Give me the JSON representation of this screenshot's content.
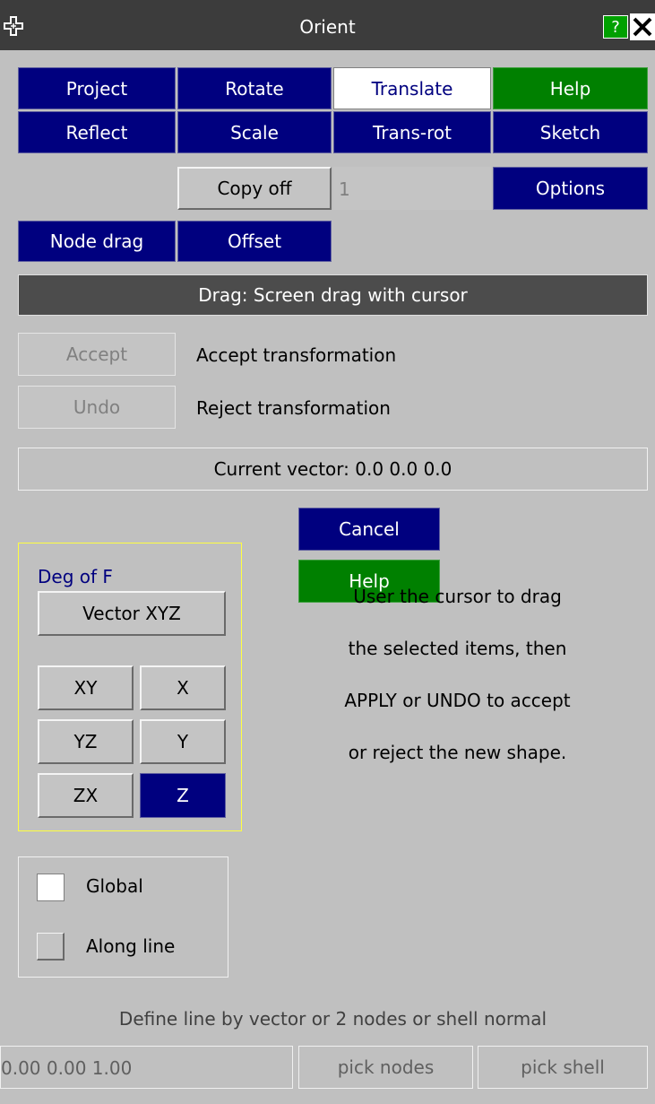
{
  "window": {
    "title": "Orient",
    "help_label": "?",
    "close_label": "✕"
  },
  "tools": {
    "project": "Project",
    "rotate": "Rotate",
    "translate": "Translate",
    "help": "Help",
    "reflect": "Reflect",
    "scale": "Scale",
    "trans_rot": "Trans-rot",
    "sketch": "Sketch"
  },
  "copy": {
    "label": "Copy off",
    "count": "1",
    "options": "Options"
  },
  "mode": {
    "node_drag": "Node drag",
    "offset": "Offset"
  },
  "drag_banner": "Drag: Screen drag with cursor",
  "accept": {
    "label": "Accept",
    "desc": "Accept transformation"
  },
  "undo": {
    "label": "Undo",
    "desc": "Reject transformation"
  },
  "current_vector": "Current vector: 0.0  0.0  0.0",
  "cancel": "Cancel",
  "help2": "Help",
  "dof": {
    "title": "Deg of F",
    "vector_xyz": "Vector XYZ",
    "xy": "XY",
    "x": "X",
    "yz": "YZ",
    "y": "Y",
    "zx": "ZX",
    "z": "Z",
    "selected": "Z"
  },
  "instructions": [
    "User the cursor to drag",
    "the selected items, then",
    "APPLY or UNDO to accept",
    "or reject the new shape."
  ],
  "frame": {
    "global": "Global",
    "along_line": "Along line"
  },
  "line": {
    "define": "Define line by vector or 2 nodes or shell normal",
    "vector_value": "0.00 0.00 1.00",
    "pick_nodes": "pick nodes",
    "pick_shell": "pick shell"
  },
  "colors": {
    "navy": "#00007f",
    "green": "#008000",
    "titlebar": "#3c3c3c",
    "background": "#c0c0c0",
    "dof_border": "#ffff40"
  }
}
